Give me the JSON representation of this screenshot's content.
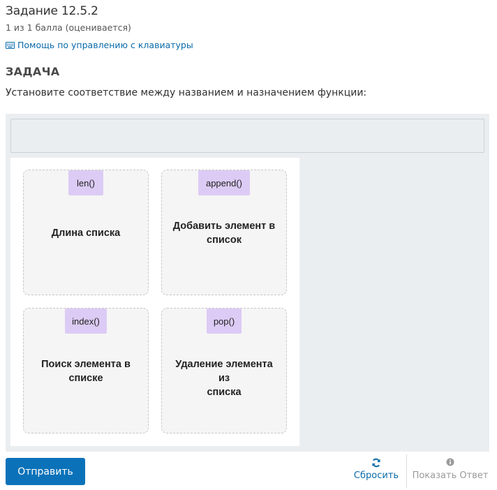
{
  "problem": {
    "title": "Задание 12.5.2",
    "points": "1 из 1 балла (оценивается)",
    "keyboard_help": "Помощь по управлению с клавиатуры",
    "task_heading": "ЗАДАЧА",
    "task_text": "Установите соответствие между названием и назначением функции:"
  },
  "zones": [
    {
      "label_line1": "Длина списка",
      "label_line2": "",
      "item": "len()"
    },
    {
      "label_line1": "Добавить элемент в",
      "label_line2": "список",
      "item": "append()"
    },
    {
      "label_line1": "Поиск элемента в",
      "label_line2": "списке",
      "item": "index()"
    },
    {
      "label_line1": "Удаление элемента из",
      "label_line2": "списка",
      "item": "pop()"
    }
  ],
  "actions": {
    "submit": "Отправить",
    "reset": "Сбросить",
    "show_answer": "Показать Ответ"
  },
  "colors": {
    "accent": "#0b72b9",
    "link": "#0a6aa8",
    "chip": "#dccbf5",
    "area_bg": "#ebeef1"
  },
  "icons": {
    "keyboard": "keyboard-icon",
    "reset": "refresh-icon",
    "show_answer": "info-icon"
  }
}
